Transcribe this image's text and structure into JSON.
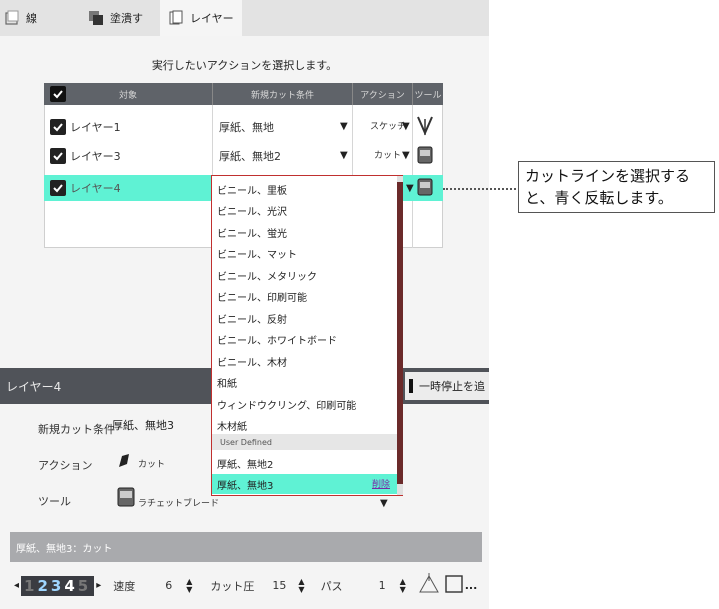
{
  "tabs": [
    {
      "label": "線"
    },
    {
      "label": "塗潰す"
    },
    {
      "label": "レイヤー"
    }
  ],
  "instruction": "実行したいアクションを選択します。",
  "table": {
    "headers": [
      "対象",
      "新規カット条件",
      "アクション",
      "ツール"
    ],
    "rows": [
      {
        "name": "レイヤー1",
        "condition": "厚紙、無地",
        "action": "スケッチ"
      },
      {
        "name": "レイヤー3",
        "condition": "厚紙、無地2",
        "action": "カット"
      },
      {
        "name": "レイヤー4",
        "condition": "",
        "action": ""
      }
    ]
  },
  "dropdown": {
    "items": [
      "ビニール、里板",
      "ビニール、光沢",
      "ビニール、蛍光",
      "ビニール、マット",
      "ビニール、メタリック",
      "ビニール、印刷可能",
      "ビニール、反射",
      "ビニール、ホワイトボード",
      "ビニール、木材",
      "和紙",
      "ウィンドウクリング、印刷可能",
      "木材紙"
    ],
    "user_defined_label": "User Defined",
    "user_items": [
      "厚紙、無地2",
      "厚紙、無地3"
    ],
    "delete_label": "削除"
  },
  "lower": {
    "header": "レイヤー4",
    "pause_label": "一時停止を追",
    "cut_condition_label": "新規カット条件",
    "cut_condition_value": "厚紙、無地3",
    "action_label": "アクション",
    "action_value": "カット",
    "tool_label": "ツール",
    "tool_value": "ラチェットブレード"
  },
  "bottom": {
    "title": "厚紙、無地3：カット",
    "passes_digits": [
      "1",
      "2",
      "3",
      "4",
      "5"
    ],
    "speed_label": "速度",
    "speed_value": "6",
    "pressure_label": "カット圧",
    "pressure_value": "15",
    "pass_label": "パス",
    "pass_value": "1",
    "more_label": "..."
  },
  "callout": "カットラインを選択すると、青く反転します。",
  "colors": {
    "highlight": "#5ff2d4",
    "header": "#5f6369",
    "dropdown_border": "#c0302f"
  }
}
